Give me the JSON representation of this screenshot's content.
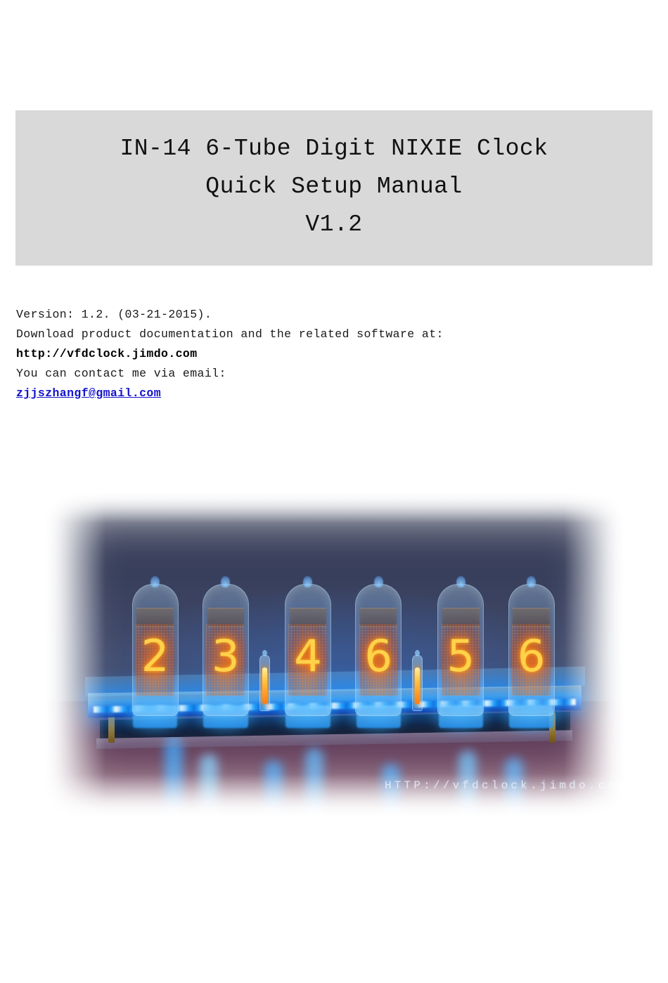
{
  "document": {
    "title_banner": {
      "lines": [
        "IN-14 6-Tube Digit NIXIE Clock",
        "Quick Setup Manual",
        "V1.2"
      ],
      "background_color": "#d9d9d9"
    },
    "meta": {
      "version_line": "Version: 1.2. (03-21-2015).",
      "download_line": "Download product documentation and the related software at:",
      "website": "http://vfdclock.jimdo.com",
      "contact_line": "You can contact me via email:",
      "email": "zjjszhangf@gmail.com",
      "link_color": "#1414cc"
    },
    "photo": {
      "alt": "IN-14 six tube nixie clock on a blue LED lit acrylic base",
      "watermark": "HTTP://vfdclock.jimdo.com",
      "tube_digits": [
        "2",
        "3",
        "4",
        "6",
        "5",
        "6"
      ],
      "displayed_time": "23:46:56",
      "separator_count": 2,
      "colors": {
        "backdrop": "#39405d",
        "led_blue": "#2aa8ff",
        "digit_glow": "#ffd24a",
        "tabletop": "#6b4560"
      }
    }
  }
}
